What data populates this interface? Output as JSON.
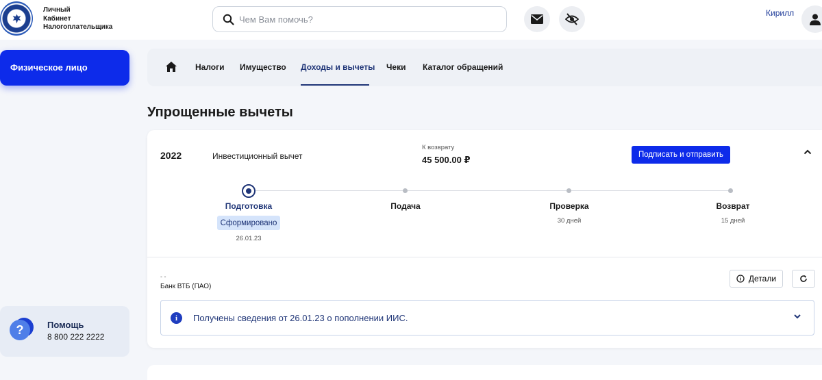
{
  "header": {
    "logo_lines": [
      "Личный",
      "Кабинет",
      "Налогоплательщика"
    ],
    "search_placeholder": "Чем Вам помочь?",
    "user_name": "Кирилл"
  },
  "sidebar": {
    "person_type": "Физическое лицо",
    "help": {
      "title": "Помощь",
      "phone": "8 800 222 2222"
    }
  },
  "nav": {
    "items": [
      "Налоги",
      "Имущество",
      "Доходы и вычеты",
      "Чеки",
      "Каталог обращений"
    ],
    "active": "Доходы и вычеты"
  },
  "page": {
    "title": "Упрощенные вычеты"
  },
  "deduction": {
    "year": "2022",
    "type": "Инвестиционный вычет",
    "refund_label": "К возврату",
    "refund_value": "45 500.00 ₽",
    "sign_button": "Подписать и отправить",
    "steps": [
      {
        "label": "Подготовка",
        "status": "Сформировано",
        "date": "26.01.23"
      },
      {
        "label": "Подача"
      },
      {
        "label": "Проверка",
        "sub": "30 дней"
      },
      {
        "label": "Возврат",
        "sub": "15 дней"
      }
    ],
    "bank_dots": "- -",
    "bank_name": "Банк ВТБ (ПАО)",
    "details_button": "Детали",
    "info_message": "Получены сведения от 26.01.23 о пополнении ИИС."
  },
  "colors": {
    "primary": "#0d2bea",
    "accent_dark": "#1f3577",
    "background": "#f4f6fa",
    "chip_bg": "#d5e4fb"
  },
  "icons": [
    "search-icon",
    "mail-icon",
    "eye-off-icon",
    "user-icon",
    "home-icon",
    "chevron-up-icon",
    "info-icon",
    "refresh-icon",
    "chevron-down-icon",
    "help-icon"
  ]
}
